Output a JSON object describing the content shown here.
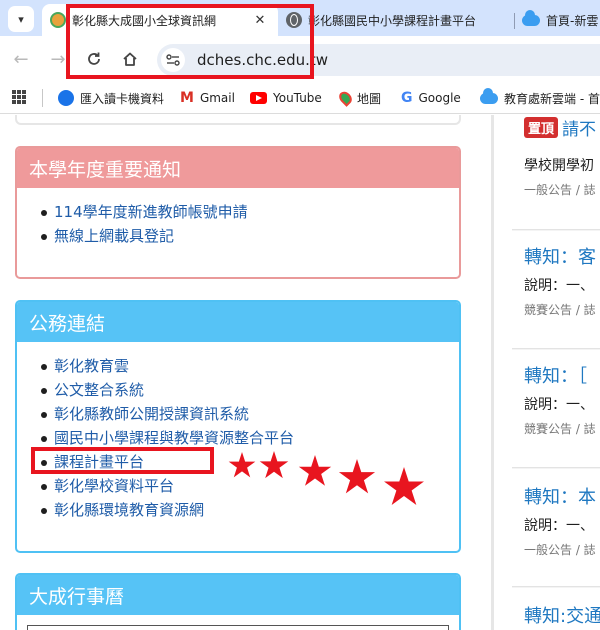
{
  "browser": {
    "tabs": [
      {
        "title": "彰化縣大成國小全球資訊網",
        "favicon": "school-favicon",
        "active": true
      },
      {
        "title": "彰化縣國民中小學課程計畫平台",
        "favicon": "globe-favicon",
        "active": false
      },
      {
        "title": "首頁-新雲",
        "favicon": "cloud-favicon",
        "active": false
      }
    ],
    "tab_close_glyph": "✕",
    "url": "dches.chc.edu.tw",
    "bookmarks": [
      {
        "label": "匯入讀卡機資料",
        "icon": "import-icon"
      },
      {
        "label": "Gmail",
        "icon": "gmail-icon"
      },
      {
        "label": "YouTube",
        "icon": "youtube-icon"
      },
      {
        "label": "地圖",
        "icon": "maps-icon"
      },
      {
        "label": "Google",
        "icon": "google-icon"
      },
      {
        "label": "教育處新雲端 - 首頁",
        "icon": "cloud-icon"
      }
    ]
  },
  "notice": {
    "title": "本學年度重要通知",
    "items": [
      "114學年度新進教師帳號申請",
      "無線上網載具登記"
    ]
  },
  "links": {
    "title": "公務連結",
    "items": [
      "彰化教育雲",
      "公文整合系統",
      "彰化縣教師公開授課資訊系統",
      "國民中小學課程與教學資源整合平台",
      "課程計畫平台",
      "彰化學校資料平台",
      "彰化縣環境教育資源網"
    ]
  },
  "calendar": {
    "title": "大成行事曆"
  },
  "news": {
    "pinned": {
      "badge": "置頂",
      "title": "請不",
      "desc": "學校開學初",
      "meta": "一般公告 / 誌"
    },
    "items": [
      {
        "title": "轉知：客",
        "desc": "說明：一、",
        "meta": "競賽公告 / 誌"
      },
      {
        "title": "轉知：［",
        "desc": "說明：一、",
        "meta": "競賽公告 / 誌"
      },
      {
        "title": "轉知：本",
        "desc": "說明：一、",
        "meta": "一般公告 / 誌"
      },
      {
        "title": "轉知:交通"
      }
    ]
  },
  "colors": {
    "annotation": "#e8151f",
    "notice_header": "#ef9a9b",
    "links_header": "#56c3f6",
    "link_text": "#1f5ca8"
  }
}
